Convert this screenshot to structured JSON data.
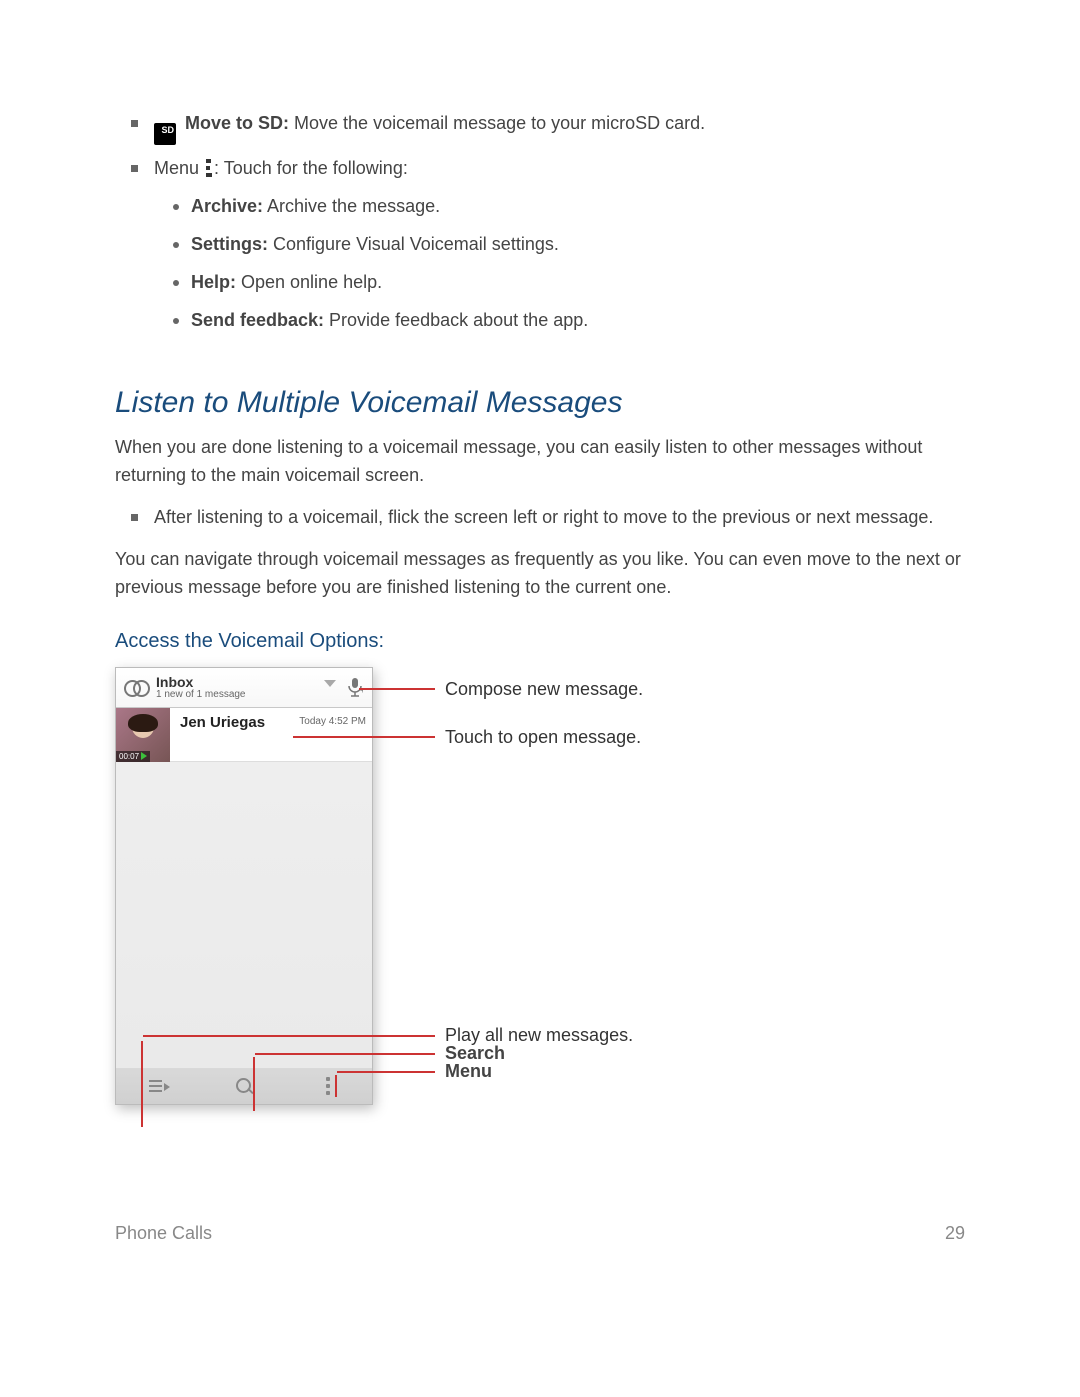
{
  "items": {
    "move_to_sd": {
      "label": "Move to SD:",
      "text": "  Move the voicemail message to your microSD card."
    },
    "menu_intro_prefix": "Menu",
    "menu_intro_suffix": ": Touch for the following:",
    "archive": {
      "label": "Archive:",
      "text": "  Archive the message."
    },
    "settings": {
      "label": "Settings:",
      "text": "  Configure Visual Voicemail settings."
    },
    "help": {
      "label": "Help:",
      "text": "  Open online help."
    },
    "feedback": {
      "label": "Send feedback:",
      "text": "  Provide feedback about the app."
    }
  },
  "section_title": "Listen to Multiple Voicemail Messages",
  "para1": "When you are done listening to a voicemail message, you can easily listen to other messages without returning to the main voicemail screen.",
  "bullet_flick": "After listening to a voicemail, flick the screen left or right to move to the previous or next message.",
  "para2": "You can navigate through voicemail messages as frequently as you like. You can even move to the next or previous message before you are finished listening to the current one.",
  "sub_title": "Access the Voicemail Options:",
  "vm": {
    "inbox_title": "Inbox",
    "inbox_sub": "1 new of 1 message",
    "sender": "Jen Uriegas",
    "time": "Today 4:52 PM",
    "duration": "00:07"
  },
  "callouts": {
    "compose": "Compose new message.",
    "open": "Touch to open message.",
    "playall": "Play all new messages.",
    "search": "Search",
    "menu": "Menu"
  },
  "footer": {
    "left": "Phone Calls",
    "right": "29"
  }
}
